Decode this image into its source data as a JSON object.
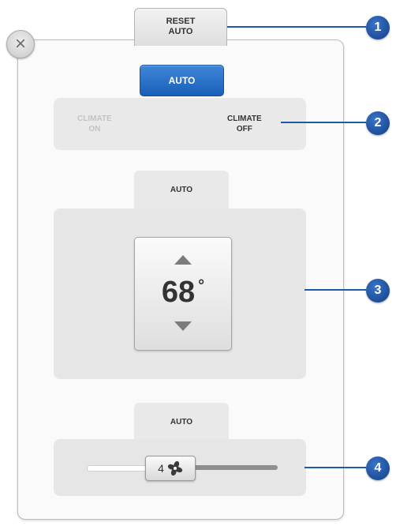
{
  "reset_tab": {
    "line1": "RESET",
    "line2": "AUTO"
  },
  "close_button": {
    "icon": "close-icon",
    "glyph": "×"
  },
  "mode": {
    "auto_label": "AUTO"
  },
  "climate": {
    "on_line1": "CLIMATE",
    "on_line2": "ON",
    "off_line1": "CLIMATE",
    "off_line2": "OFF",
    "on_state": "disabled",
    "off_state": "active"
  },
  "temperature": {
    "tab_label": "AUTO",
    "value": "68",
    "unit": "°"
  },
  "fan": {
    "tab_label": "AUTO",
    "speed": "4",
    "fan_icon": "fan-icon"
  },
  "callouts": [
    "1",
    "2",
    "3",
    "4"
  ],
  "colors": {
    "accent": "#1f5fb8",
    "callout": "#1f5aa6",
    "panel": "#fafafa",
    "zone": "#e6e6e6"
  }
}
